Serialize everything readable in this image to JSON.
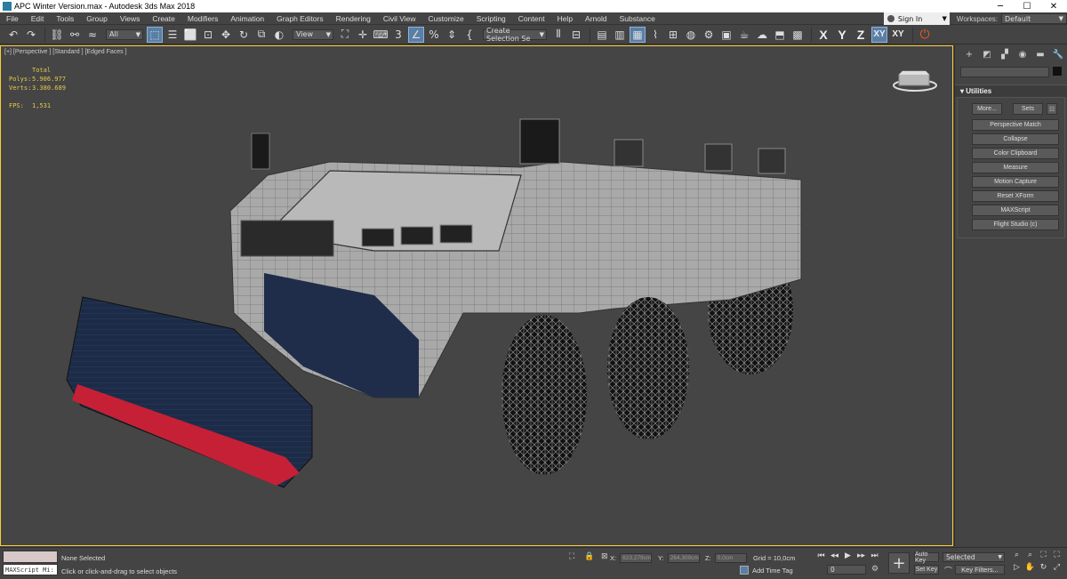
{
  "titlebar": {
    "title": "APC Winter Version.max - Autodesk 3ds Max 2018",
    "minimize": "─",
    "maximize": "☐",
    "close": "✕"
  },
  "menu": {
    "items": [
      "File",
      "Edit",
      "Tools",
      "Group",
      "Views",
      "Create",
      "Modifiers",
      "Animation",
      "Graph Editors",
      "Rendering",
      "Civil View",
      "Customize",
      "Scripting",
      "Content",
      "Help",
      "Arnold",
      "Substance"
    ],
    "sign_in": "Sign In",
    "workspaces_label": "Workspaces:",
    "workspaces_value": "Default"
  },
  "toolbar": {
    "selection_filter": "All",
    "reference_coord": "View",
    "named_selection": "Create Selection Se",
    "axis_x": "X",
    "axis_y": "Y",
    "axis_z": "Z",
    "axis_xy": "XY",
    "axis_xy2": "XY"
  },
  "viewport": {
    "label": "[+] [Perspective ] [Standard ] [Edged Faces ]",
    "stats": {
      "total_label": "Total",
      "polys_label": "Polys:",
      "polys_value": "5.906.977",
      "verts_label": "Verts:",
      "verts_value": "3.380.689",
      "fps_label": "FPS:",
      "fps_value": "1,531"
    }
  },
  "command_panel": {
    "rollout_title": "Utilities",
    "more_button": "More...",
    "sets_button": "Sets",
    "utilities": [
      "Perspective Match",
      "Collapse",
      "Color Clipboard",
      "Measure",
      "Motion Capture",
      "Reset XForm",
      "MAXScript",
      "Flight Studio (c)"
    ]
  },
  "status": {
    "maxscript_placeholder": "MAXScript Mi:",
    "selection": "None Selected",
    "prompt": "Click or click-and-drag to select objects",
    "x_label": "X:",
    "x_value": "623,279cm",
    "y_label": "Y:",
    "y_value": "264,300cm",
    "z_label": "Z:",
    "z_value": "0,0cm",
    "grid": "Grid = 10,0cm",
    "add_time_tag": "Add Time Tag",
    "frame": "0",
    "auto_key": "Auto Key",
    "set_key": "Set Key",
    "selected": "Selected",
    "key_filters": "Key Filters..."
  },
  "colors": {
    "viewport_border": "#ffcc33",
    "stats_text": "#e8c84a",
    "active_button": "#5a7fa6"
  }
}
